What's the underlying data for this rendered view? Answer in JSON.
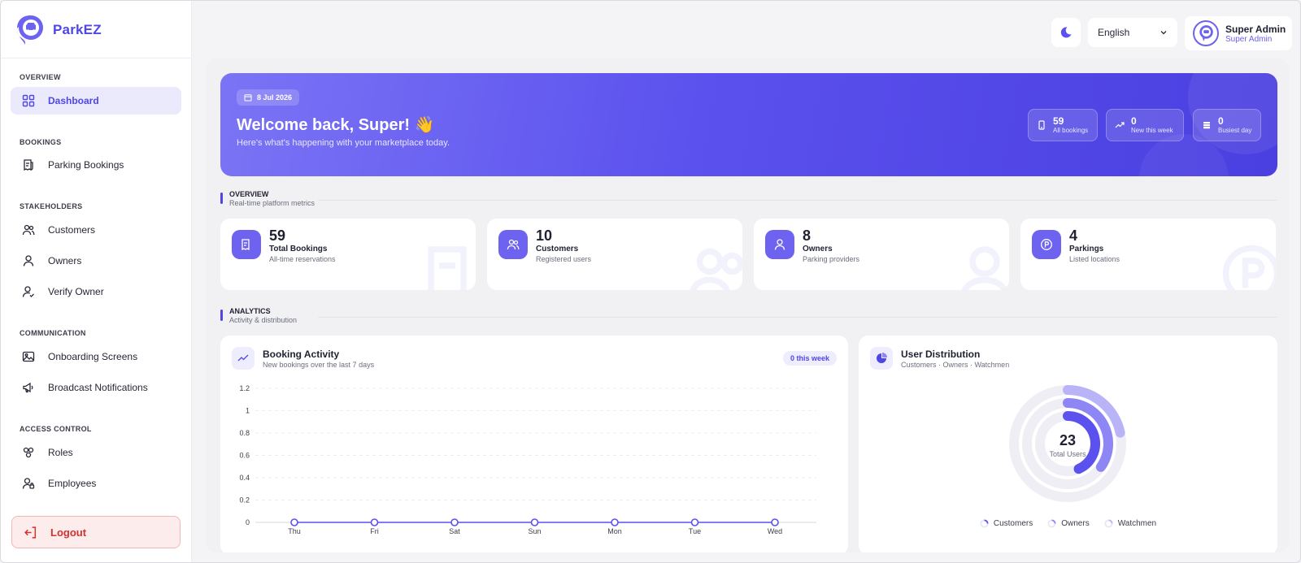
{
  "brand": {
    "name": "ParkEZ"
  },
  "sidebar": {
    "sections": {
      "overview": "OVERVIEW",
      "bookings": "BOOKINGS",
      "stakeholders": "STAKEHOLDERS",
      "communication": "COMMUNICATION",
      "access": "ACCESS CONTROL"
    },
    "items": [
      {
        "label": "Dashboard",
        "icon": "grid-icon"
      },
      {
        "label": "Parking Bookings",
        "icon": "receipt-icon"
      },
      {
        "label": "Customers",
        "icon": "users-icon"
      },
      {
        "label": "Owners",
        "icon": "user-icon"
      },
      {
        "label": "Verify Owner",
        "icon": "user-check-icon"
      },
      {
        "label": "Onboarding Screens",
        "icon": "image-icon"
      },
      {
        "label": "Broadcast Notifications",
        "icon": "megaphone-icon"
      },
      {
        "label": "Roles",
        "icon": "roles-icon"
      },
      {
        "label": "Employees",
        "icon": "employee-icon"
      }
    ],
    "logout": "Logout"
  },
  "topbar": {
    "language": "English",
    "user": {
      "name": "Super Admin",
      "role": "Super Admin"
    }
  },
  "hero": {
    "date": "8 Jul 2026",
    "title": "Welcome back, Super! 👋",
    "subtitle": "Here's what's happening with your marketplace today.",
    "stats": [
      {
        "value": "59",
        "label": "All bookings"
      },
      {
        "value": "0",
        "label": "New this week"
      },
      {
        "value": "0",
        "label": "Busiest day"
      }
    ]
  },
  "overview": {
    "title": "OVERVIEW",
    "subtitle": "Real-time platform metrics",
    "cards": [
      {
        "value": "59",
        "label": "Total Bookings",
        "desc": "All-time reservations"
      },
      {
        "value": "10",
        "label": "Customers",
        "desc": "Registered users"
      },
      {
        "value": "8",
        "label": "Owners",
        "desc": "Parking providers"
      },
      {
        "value": "4",
        "label": "Parkings",
        "desc": "Listed locations"
      }
    ]
  },
  "analytics": {
    "title": "ANALYTICS",
    "subtitle": "Activity & distribution",
    "booking": {
      "title": "Booking Activity",
      "subtitle": "New bookings over the last 7 days",
      "badge": "0 this week"
    },
    "distribution": {
      "title": "User Distribution",
      "subtitle": "Customers · Owners · Watchmen",
      "total": "23",
      "total_label": "Total Users"
    }
  },
  "colors": {
    "accent": "#4f46e5",
    "accent_light": "#6d63f0",
    "danger": "#d32f2f"
  },
  "chart_data": [
    {
      "type": "line",
      "title": "Booking Activity",
      "categories": [
        "Thu",
        "Fri",
        "Sat",
        "Sun",
        "Mon",
        "Tue",
        "Wed"
      ],
      "series": [
        {
          "values": [
            0,
            0,
            0,
            0,
            0,
            0,
            0
          ]
        }
      ],
      "yticks": [
        "0",
        "0.2",
        "0.4",
        "0.6",
        "0.8",
        "1",
        "1.2"
      ],
      "ylim": [
        0,
        1.2
      ],
      "grid": true
    },
    {
      "type": "pie",
      "title": "User Distribution",
      "categories": [
        "Customers",
        "Owners",
        "Watchmen"
      ],
      "values": [
        10,
        8,
        5
      ],
      "total": 23
    }
  ]
}
